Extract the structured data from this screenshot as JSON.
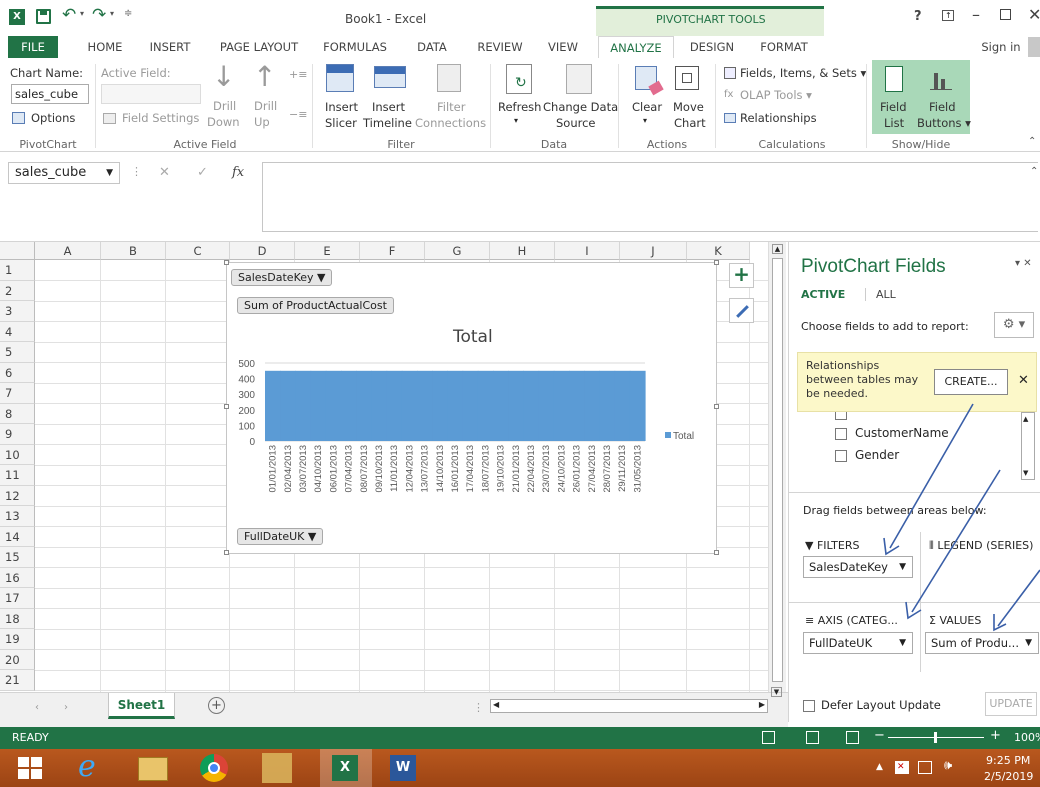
{
  "window": {
    "title": "Book1 - Excel",
    "context_header": "PIVOTCHART TOOLS",
    "help": "?",
    "sign_in": "Sign in"
  },
  "tabs": [
    "FILE",
    "HOME",
    "INSERT",
    "PAGE LAYOUT",
    "FORMULAS",
    "DATA",
    "REVIEW",
    "VIEW",
    "ANALYZE",
    "DESIGN",
    "FORMAT"
  ],
  "ribbon": {
    "chart_name_label": "Chart Name:",
    "chart_name_value": "sales_cube",
    "options": "Options",
    "active_field_label": "Active Field:",
    "field_settings": "Field Settings",
    "drill_down": [
      "Drill",
      "Down"
    ],
    "drill_up": [
      "Drill",
      "Up"
    ],
    "insert_slicer": [
      "Insert",
      "Slicer"
    ],
    "insert_timeline": [
      "Insert",
      "Timeline"
    ],
    "filter_connections": [
      "Filter",
      "Connections"
    ],
    "refresh": "Refresh",
    "change_data_source": [
      "Change Data",
      "Source"
    ],
    "clear": "Clear",
    "move_chart": [
      "Move",
      "Chart"
    ],
    "fields_items_sets": "Fields, Items, & Sets",
    "olap_tools": "OLAP Tools",
    "relationships": "Relationships",
    "field_list": [
      "Field",
      "List"
    ],
    "field_buttons": [
      "Field",
      "Buttons"
    ],
    "groups": [
      "PivotChart",
      "Active Field",
      "Filter",
      "Data",
      "Actions",
      "Calculations",
      "Show/Hide"
    ]
  },
  "formula_bar": {
    "name_box": "sales_cube",
    "fx": "fx",
    "cancel": "✕",
    "enter": "✓"
  },
  "grid": {
    "columns": [
      "A",
      "B",
      "C",
      "D",
      "E",
      "F",
      "G",
      "H",
      "I",
      "J",
      "K"
    ],
    "rows": [
      "1",
      "2",
      "3",
      "4",
      "5",
      "6",
      "7",
      "8",
      "9",
      "10",
      "11",
      "12",
      "13",
      "14",
      "15",
      "16",
      "17",
      "18",
      "19",
      "20",
      "21"
    ]
  },
  "chart_data": {
    "type": "bar",
    "title": "Total",
    "filter_button": "SalesDateKey",
    "value_button": "Sum of ProductActualCost",
    "axis_button": "FullDateUK",
    "legend": "Total",
    "ylim": [
      0,
      500
    ],
    "yticks": [
      "500",
      "400",
      "300",
      "200",
      "100",
      "0"
    ],
    "categories": [
      "01/01/2013",
      "02/04/2013",
      "03/07/2013",
      "04/10/2013",
      "06/01/2013",
      "07/04/2013",
      "08/07/2013",
      "09/10/2013",
      "11/01/2013",
      "12/04/2013",
      "13/07/2013",
      "14/10/2013",
      "16/01/2013",
      "17/04/2013",
      "18/07/2013",
      "19/10/2013",
      "21/01/2013",
      "22/04/2013",
      "23/07/2013",
      "24/10/2013",
      "26/01/2013",
      "27/04/2013",
      "28/07/2013",
      "29/11/2013",
      "31/05/2013"
    ],
    "series": [
      {
        "name": "Total",
        "values": [
          450,
          450,
          450,
          450,
          450,
          450,
          450,
          450,
          450,
          450,
          450,
          450,
          450,
          450,
          450,
          450,
          450,
          450,
          450,
          450,
          450,
          450,
          450,
          450,
          450
        ]
      }
    ],
    "color": "#5b9bd5"
  },
  "pane": {
    "title": "PivotChart Fields",
    "tab_active": "ACTIVE",
    "tab_all": "ALL",
    "choose": "Choose fields to add to report:",
    "notice": [
      "Relationships",
      "between tables may",
      "be needed."
    ],
    "create": "CREATE...",
    "fields": [
      "CustomerName",
      "Gender"
    ],
    "drag": "Drag fields between areas below:",
    "filters": "FILTERS",
    "legend": "LEGEND (SERIES)",
    "axis": "AXIS (CATEG...",
    "values": "VALUES",
    "filters_value": "SalesDateKey",
    "axis_value": "FullDateUK",
    "values_value": "Sum of Produ...",
    "defer": "Defer Layout Update",
    "update": "UPDATE"
  },
  "sheet_tab": "Sheet1",
  "status": {
    "ready": "READY",
    "zoom": "100%"
  },
  "taskbar": {
    "time": "9:25 PM",
    "date": "2/5/2019"
  }
}
